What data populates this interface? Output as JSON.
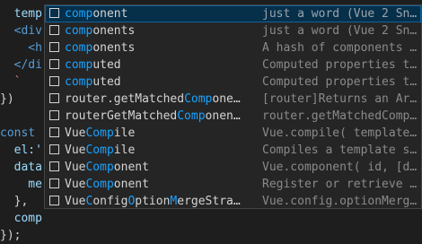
{
  "editor": {
    "lines": [
      {
        "seg": [
          {
            "t": "  temp",
            "c": "prop"
          }
        ]
      },
      {
        "seg": [
          {
            "t": "  <div",
            "c": "tag"
          }
        ]
      },
      {
        "seg": [
          {
            "t": "    <h",
            "c": "tag"
          }
        ]
      },
      {
        "seg": [
          {
            "t": "  </di",
            "c": "tag"
          }
        ]
      },
      {
        "seg": [
          {
            "t": "  `",
            "c": "str"
          }
        ]
      },
      {
        "seg": [
          {
            "t": "})",
            "c": "br"
          }
        ]
      },
      {
        "seg": [
          {
            "t": "",
            "c": "br"
          }
        ]
      },
      {
        "seg": [
          {
            "t": "const",
            "c": "kw"
          }
        ]
      },
      {
        "seg": [
          {
            "t": "  el:'",
            "c": "prop"
          }
        ]
      },
      {
        "seg": [
          {
            "t": "  data",
            "c": "prop"
          }
        ]
      },
      {
        "seg": [
          {
            "t": "    me",
            "c": "prop"
          }
        ]
      },
      {
        "seg": [
          {
            "t": "  },",
            "c": "br"
          }
        ]
      },
      {
        "seg": [
          {
            "t": "  comp",
            "c": "prop"
          }
        ]
      },
      {
        "seg": [
          {
            "t": "});",
            "c": "br"
          }
        ]
      }
    ]
  },
  "suggestions": [
    {
      "label_parts": [
        {
          "t": "comp",
          "m": true
        },
        {
          "t": "onent",
          "m": false
        }
      ],
      "detail": "just a word (Vue 2 Sn…",
      "selected": true
    },
    {
      "label_parts": [
        {
          "t": "comp",
          "m": true
        },
        {
          "t": "onents",
          "m": false
        }
      ],
      "detail": "just a word (Vue 2 Sn…",
      "selected": false
    },
    {
      "label_parts": [
        {
          "t": "comp",
          "m": true
        },
        {
          "t": "onents",
          "m": false
        }
      ],
      "detail": "A hash of components …",
      "selected": false
    },
    {
      "label_parts": [
        {
          "t": "comp",
          "m": true
        },
        {
          "t": "uted",
          "m": false
        }
      ],
      "detail": "Computed properties t…",
      "selected": false
    },
    {
      "label_parts": [
        {
          "t": "comp",
          "m": true
        },
        {
          "t": "uted",
          "m": false
        }
      ],
      "detail": "Computed properties t…",
      "selected": false
    },
    {
      "label_parts": [
        {
          "t": "router.getMatched",
          "m": false
        },
        {
          "t": "Comp",
          "m": true
        },
        {
          "t": "one…",
          "m": false
        }
      ],
      "detail": "[router]Returns an Ar…",
      "selected": false
    },
    {
      "label_parts": [
        {
          "t": "routerGetMatched",
          "m": false
        },
        {
          "t": "Comp",
          "m": true
        },
        {
          "t": "onen…",
          "m": false
        }
      ],
      "detail": "router.getMatchedComp…",
      "selected": false
    },
    {
      "label_parts": [
        {
          "t": "Vue",
          "m": false
        },
        {
          "t": "Comp",
          "m": true
        },
        {
          "t": "ile",
          "m": false
        }
      ],
      "detail": "Vue.compile( template…",
      "selected": false
    },
    {
      "label_parts": [
        {
          "t": "Vue",
          "m": false
        },
        {
          "t": "Comp",
          "m": true
        },
        {
          "t": "ile",
          "m": false
        }
      ],
      "detail": "Compiles a template s…",
      "selected": false
    },
    {
      "label_parts": [
        {
          "t": "Vue",
          "m": false
        },
        {
          "t": "Comp",
          "m": true
        },
        {
          "t": "onent",
          "m": false
        }
      ],
      "detail": "Vue.component( id, [d…",
      "selected": false
    },
    {
      "label_parts": [
        {
          "t": "Vue",
          "m": false
        },
        {
          "t": "Comp",
          "m": true
        },
        {
          "t": "onent",
          "m": false
        }
      ],
      "detail": "Register or retrieve …",
      "selected": false
    },
    {
      "label_parts": [
        {
          "t": "Vue",
          "m": false
        },
        {
          "t": "C",
          "m": true
        },
        {
          "t": "onfig",
          "m": false
        },
        {
          "t": "O",
          "m": true
        },
        {
          "t": "ption",
          "m": false
        },
        {
          "t": "M",
          "m": true
        },
        {
          "t": "ergeStra…",
          "m": false
        }
      ],
      "detail": "Vue.config.optionMerg…",
      "selected": false
    }
  ],
  "icon_name": "text-word-icon",
  "colors": {
    "background": "#1e1e1e",
    "widget": "#252526",
    "selected_row": "#062f4a",
    "match_highlight": "#18a3ff"
  }
}
